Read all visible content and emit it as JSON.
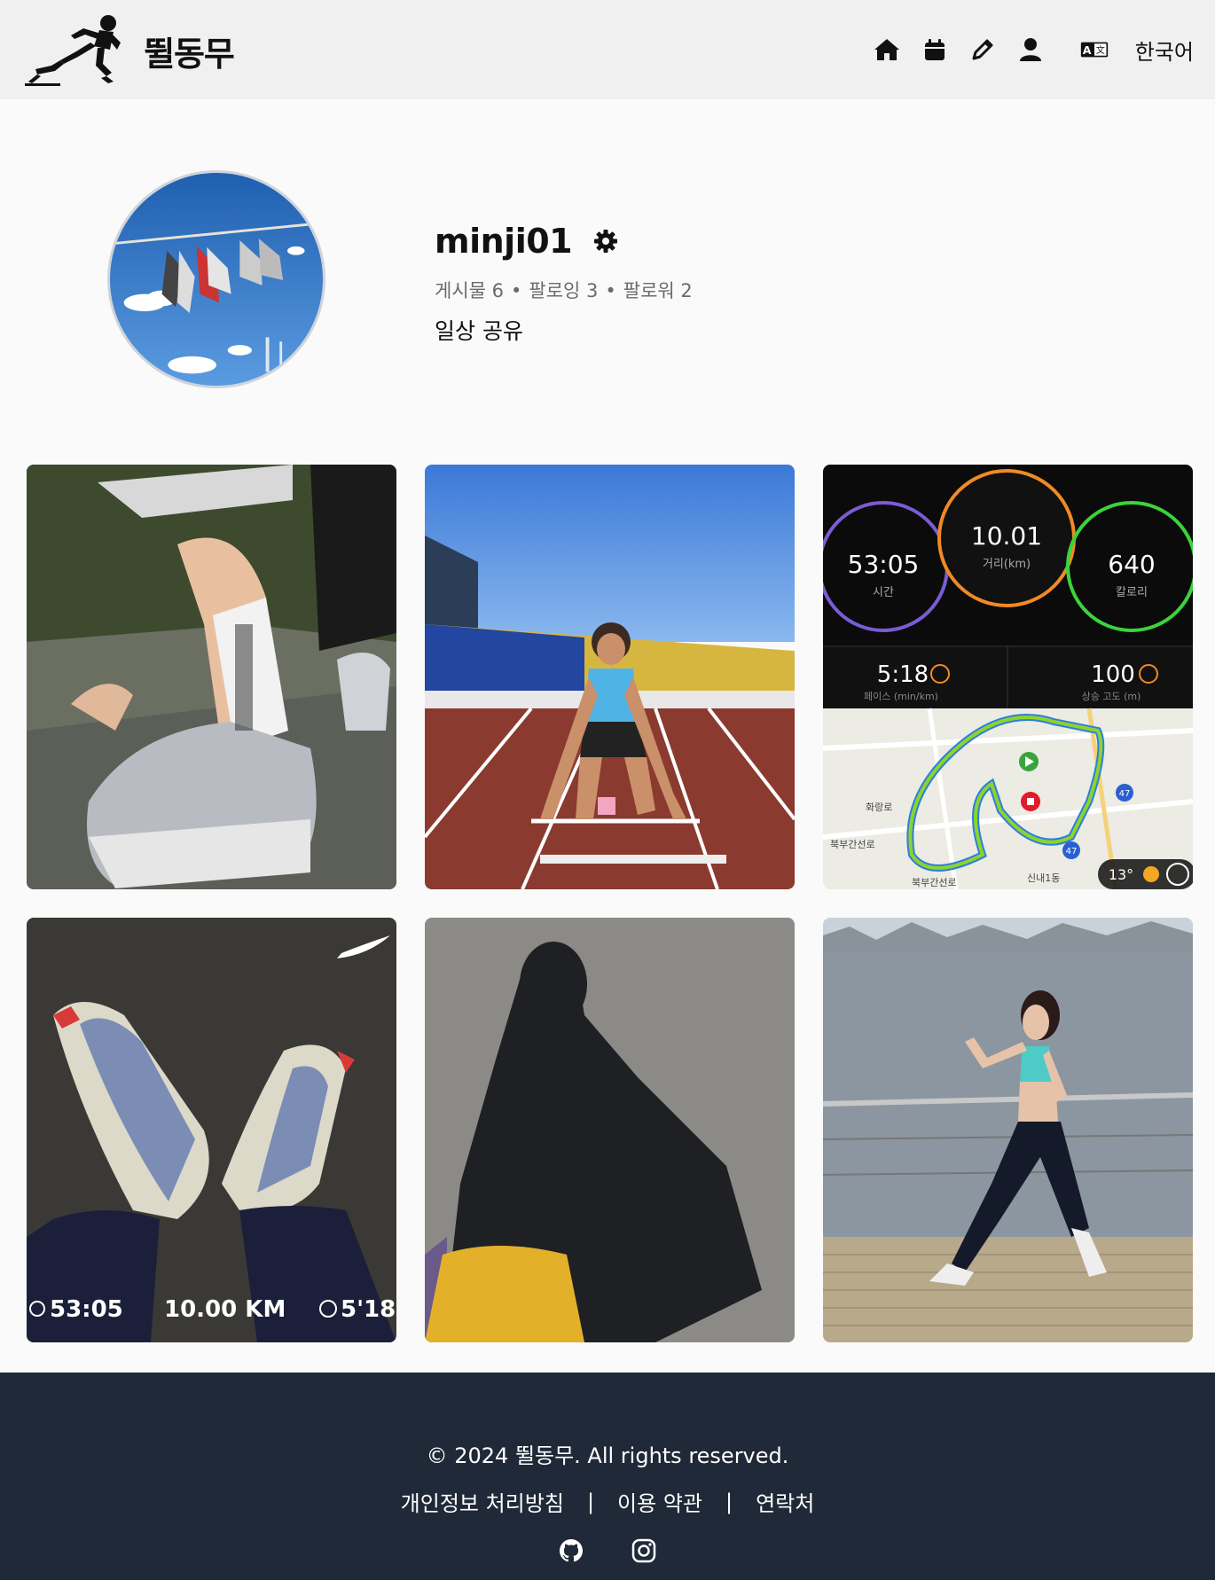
{
  "header": {
    "logo_text": "뛸동무",
    "nav_icons": [
      "home-icon",
      "calendar-icon",
      "pencil-icon",
      "user-icon"
    ],
    "language_icon": "translate-icon",
    "language": "한국어"
  },
  "profile": {
    "username": "minji01",
    "stats": {
      "posts": "게시물 6",
      "following": "팔로잉 3",
      "followers": "팔로워 2",
      "separator": "•"
    },
    "bio": "일상 공유"
  },
  "posts": [
    {
      "description": "On running shoe and sock close-up"
    },
    {
      "description": "Runner in start position on track"
    },
    {
      "description": "Run summary screenshot",
      "time": "53:05",
      "time_label": "시간",
      "distance": "10.01",
      "distance_label": "거리(km)",
      "calories": "640",
      "calories_label": "칼로리",
      "pace": "5:18",
      "pace_label": "페이스 (min/km)",
      "elevation": "100",
      "elevation_label": "상승 고도 (m)",
      "road_1": "북부간선로",
      "road_2": "북부간선로",
      "road_3": "화랑로",
      "road_4": "신내1동",
      "route_badge_1": "47",
      "route_badge_2": "47",
      "temperature": "13°"
    },
    {
      "description": "Running shoes on asphalt with run stats",
      "time": "53:05",
      "distance": "10.00 KM",
      "pace": "5'18'"
    },
    {
      "description": "Shadow selfie on asphalt"
    },
    {
      "description": "Runner by the river"
    }
  ],
  "footer": {
    "copyright": "© 2024 뛸동무. All rights reserved.",
    "links": [
      "개인정보 처리방침",
      "이용 약관",
      "연락처"
    ],
    "separator": "|",
    "social_icons": [
      "github-icon",
      "instagram-icon"
    ]
  },
  "colors": {
    "header_bg": "#f0f0f0",
    "page_bg": "#fafafa",
    "footer_bg": "#1f2937",
    "stats_text": "#6b6b6b"
  }
}
